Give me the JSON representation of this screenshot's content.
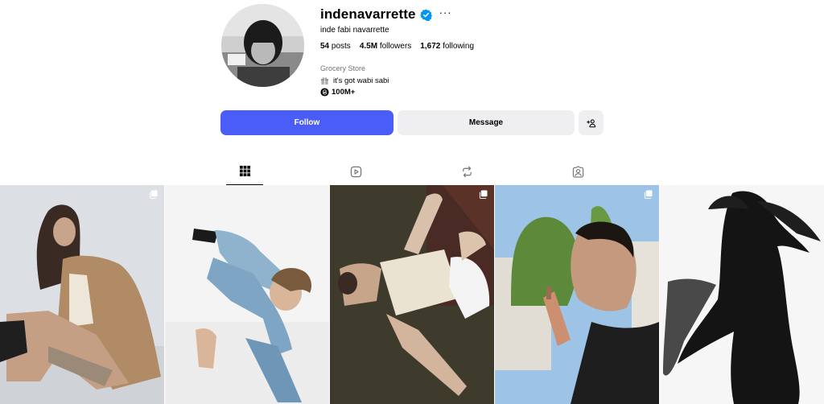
{
  "profile": {
    "username": "indenavarrette",
    "more_label": "···",
    "full_name": "inde fabi navarrette",
    "stats": [
      {
        "value": "54",
        "label": "posts"
      },
      {
        "value": "4.5M",
        "label": "followers"
      },
      {
        "value": "1,672",
        "label": "following"
      }
    ],
    "category": "Grocery Store",
    "bio": "it's got wabi sabi",
    "threads": "100M+"
  },
  "actions": {
    "follow_label": "Follow",
    "message_label": "Message"
  },
  "tabs": [
    {
      "name": "posts",
      "icon": "grid-icon",
      "active": true
    },
    {
      "name": "reels",
      "icon": "reels-icon",
      "active": false
    },
    {
      "name": "reposts",
      "icon": "repost-icon",
      "active": false
    },
    {
      "name": "tagged",
      "icon": "tagged-icon",
      "active": false
    }
  ],
  "colors": {
    "follow_button": "#4a5df9",
    "secondary_button": "#efeff1",
    "verified_badge": "#0095f6",
    "category_text": "#737373"
  },
  "posts": [
    {
      "type": "carousel",
      "icon": "carousel-icon"
    },
    {
      "type": "photo"
    },
    {
      "type": "carousel",
      "icon": "carousel-icon"
    },
    {
      "type": "carousel",
      "icon": "carousel-icon"
    },
    {
      "type": "photo"
    }
  ]
}
